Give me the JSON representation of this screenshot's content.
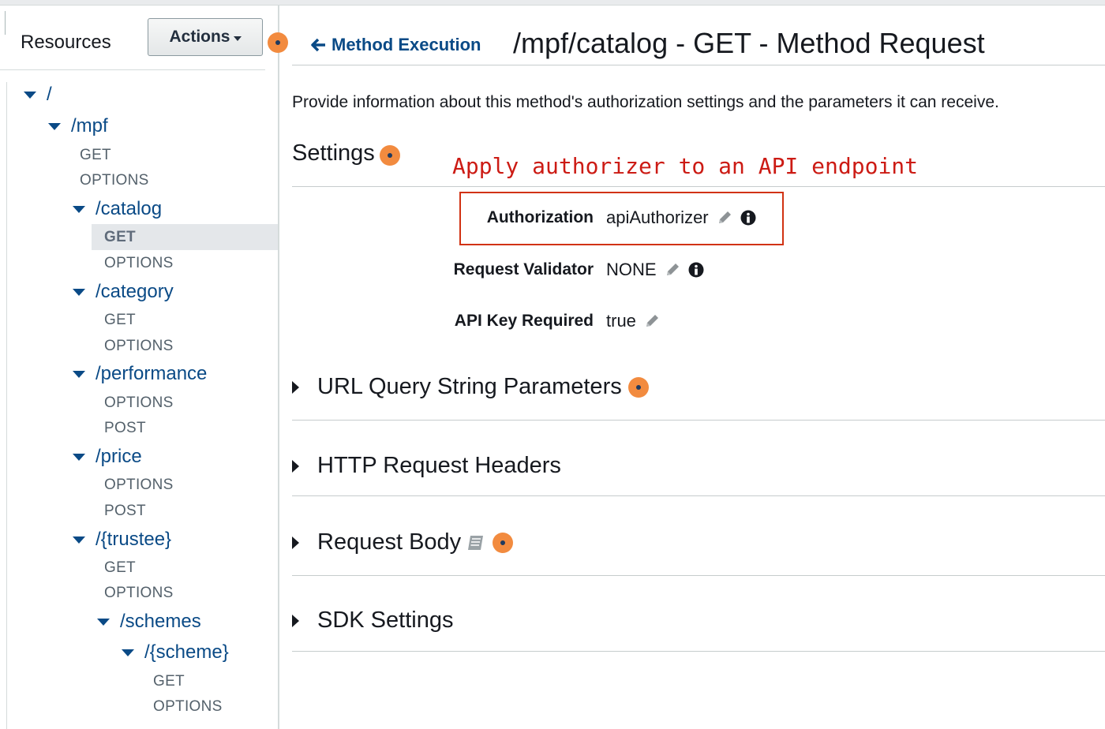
{
  "sidebar": {
    "title": "Resources",
    "actions_label": "Actions",
    "tree": {
      "root": "/",
      "mpf": "/mpf",
      "mpf_get": "GET",
      "mpf_options": "OPTIONS",
      "catalog": "/catalog",
      "catalog_get": "GET",
      "catalog_options": "OPTIONS",
      "category": "/category",
      "category_get": "GET",
      "category_options": "OPTIONS",
      "performance": "/performance",
      "performance_options": "OPTIONS",
      "performance_post": "POST",
      "price": "/price",
      "price_options": "OPTIONS",
      "price_post": "POST",
      "trustee": "/{trustee}",
      "trustee_get": "GET",
      "trustee_options": "OPTIONS",
      "schemes": "/schemes",
      "scheme": "/{scheme}",
      "scheme_get": "GET",
      "scheme_options": "OPTIONS"
    }
  },
  "header": {
    "back_label": "Method Execution",
    "title": "/mpf/catalog - GET - Method Request"
  },
  "main": {
    "description": "Provide information about this method's authorization settings and the parameters it can receive.",
    "settings_title": "Settings",
    "annotation": "Apply authorizer to an API endpoint",
    "settings": {
      "authorization_label": "Authorization",
      "authorization_value": "apiAuthorizer",
      "validator_label": "Request Validator",
      "validator_value": "NONE",
      "api_key_label": "API Key Required",
      "api_key_value": "true"
    },
    "sections": {
      "query": "URL Query String Parameters",
      "headers": "HTTP Request Headers",
      "body": "Request Body",
      "sdk": "SDK Settings"
    }
  },
  "colors": {
    "link": "#0a4a86",
    "annotation": "#cc1b14",
    "dot": "#f28b3f",
    "highlight_border": "#d13212"
  }
}
